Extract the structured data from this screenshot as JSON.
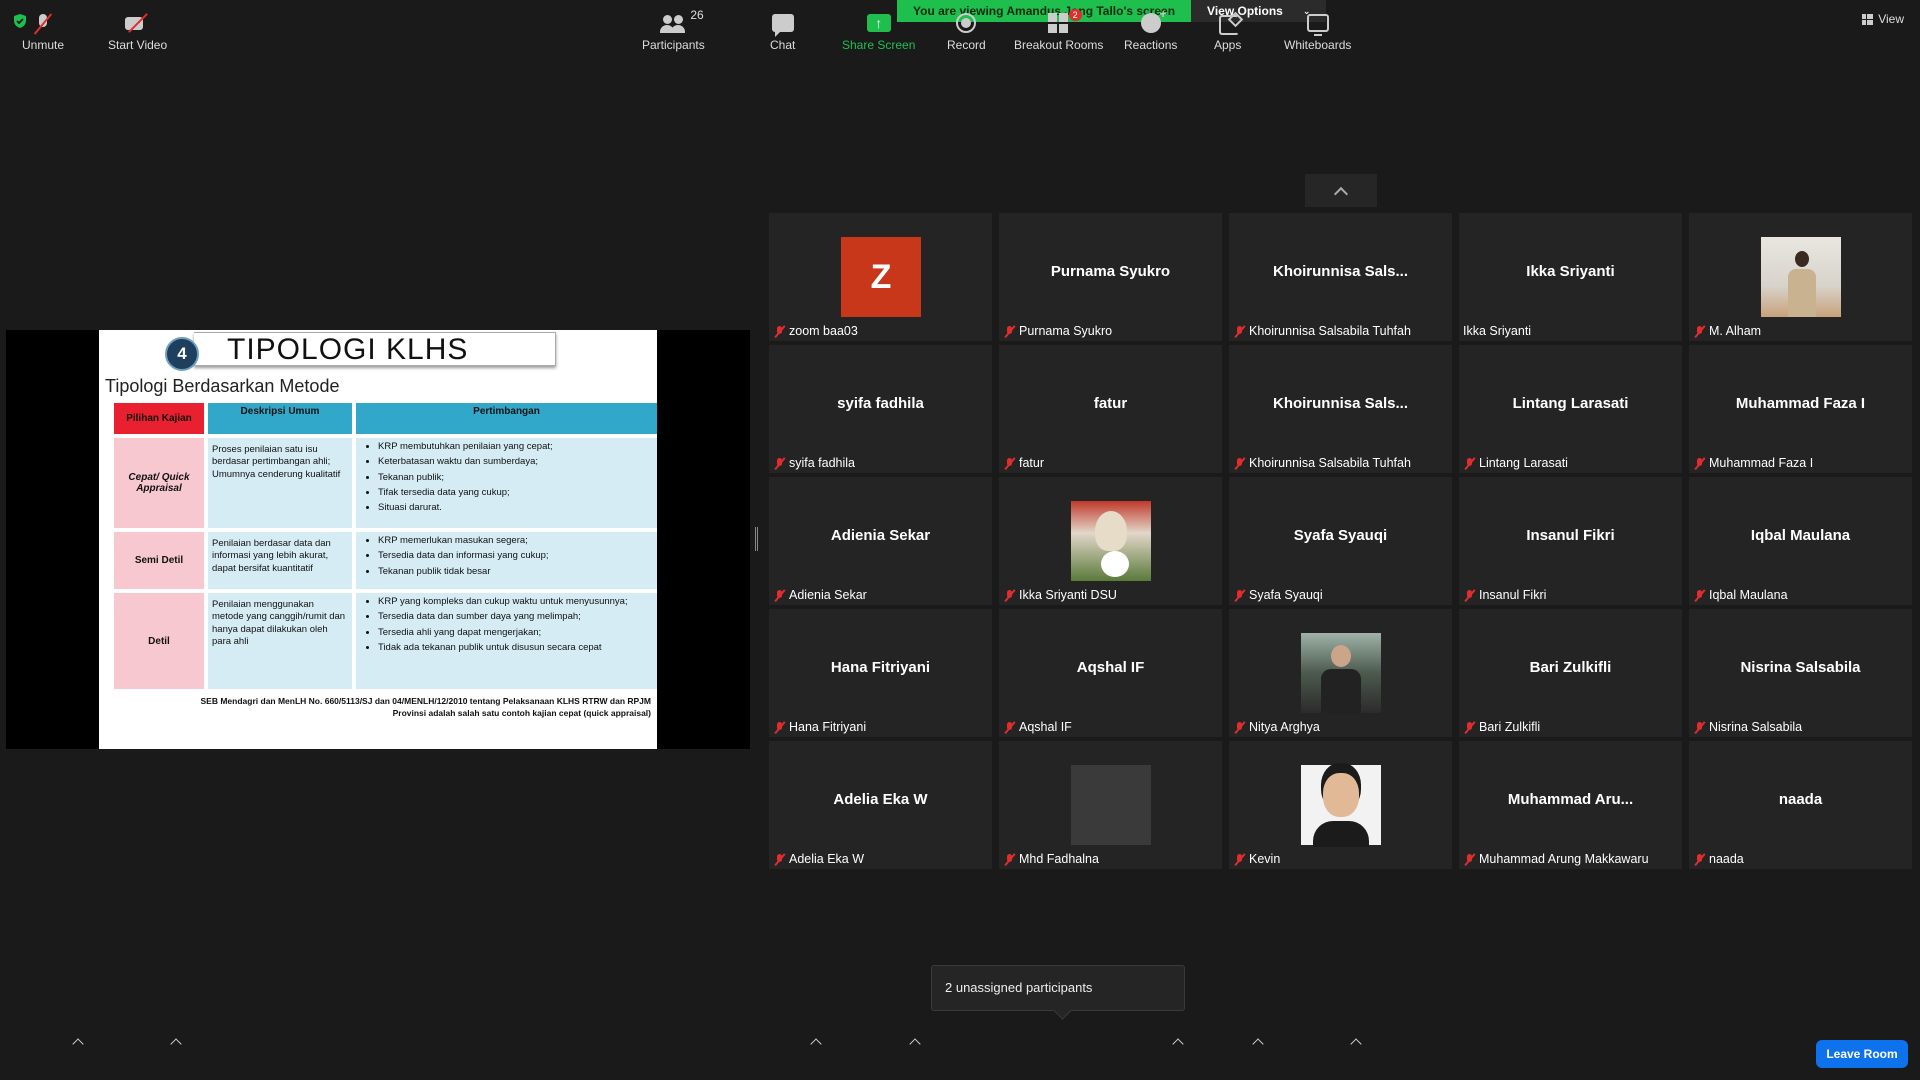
{
  "banner": {
    "viewing_text": "You are viewing Amandus Jong Tallo's screen",
    "view_options_label": "View Options"
  },
  "view_label": "View",
  "slide": {
    "number": "4",
    "title": "TIPOLOGI  KLHS",
    "subtitle": "Tipologi Berdasarkan Metode",
    "headers": [
      "Pilihan Kajian",
      "Deskripsi Umum",
      "Pertimbangan"
    ],
    "rows": [
      {
        "label": "Cepat/ Quick Appraisal",
        "desc": "Proses penilaian satu isu berdasar pertimbangan ahli; Umumnya cenderung kualitatif",
        "points": [
          "KRP membutuhkan penilaian yang cepat;",
          "Keterbatasan waktu dan sumberdaya;",
          "Tekanan publik;",
          "Tifak tersedia data yang cukup;",
          "Situasi darurat."
        ]
      },
      {
        "label": "Semi Detil",
        "desc": "Penilaian berdasar data dan informasi yang lebih akurat, dapat bersifat kuantitatif",
        "points": [
          "KRP memerlukan masukan segera;",
          "Tersedia data dan informasi yang cukup;",
          "Tekanan publik tidak besar"
        ]
      },
      {
        "label": "Detil",
        "desc": "Penilaian menggunakan metode yang canggih/rumit dan hanya dapat dilakukan oleh para ahli",
        "points": [
          "KRP yang kompleks dan cukup waktu untuk menyusunnya;",
          "Tersedia data dan sumber daya yang melimpah;",
          "Tersedia ahli yang dapat mengerjakan;",
          "Tidak ada tekanan publik untuk disusun secara cepat"
        ]
      }
    ],
    "footnote_line1": "SEB Mendagri dan MenLH No. 660/5113/SJ dan 04/MENLH/12/2010 tentang Pelaksanaan KLHS RTRW dan RPJM",
    "footnote_line2": "Provinsi adalah salah satu contoh kajian cepat (quick appraisal)"
  },
  "participants": [
    {
      "display": "",
      "name": "zoom baa03",
      "muted": true,
      "avatar": "Z"
    },
    {
      "display": "Purnama Syukro",
      "name": "Purnama Syukro",
      "muted": true
    },
    {
      "display": "Khoirunnisa  Sals...",
      "name": "Khoirunnisa Salsabila Tuhfah",
      "muted": true
    },
    {
      "display": "Ikka Sriyanti",
      "name": "Ikka Sriyanti",
      "muted": false
    },
    {
      "display": "",
      "name": "M. Alham",
      "muted": true,
      "photo": "alham"
    },
    {
      "display": "syifa fadhila",
      "name": "syifa fadhila",
      "muted": true
    },
    {
      "display": "fatur",
      "name": "fatur",
      "muted": true
    },
    {
      "display": "Khoirunnisa  Sals...",
      "name": "Khoirunnisa Salsabila Tuhfah",
      "muted": true
    },
    {
      "display": "Lintang Larasati",
      "name": "Lintang Larasati",
      "muted": true
    },
    {
      "display": "Muhammad Faza I",
      "name": "Muhammad Faza I",
      "muted": true
    },
    {
      "display": "Adienia Sekar",
      "name": "Adienia Sekar",
      "muted": true
    },
    {
      "display": "",
      "name": "Ikka Sriyanti DSU",
      "muted": true,
      "photo": "ikka"
    },
    {
      "display": "Syafa Syauqi",
      "name": "Syafa Syauqi",
      "muted": true
    },
    {
      "display": "Insanul Fikri",
      "name": "Insanul Fikri",
      "muted": true
    },
    {
      "display": "Iqbal Maulana",
      "name": "Iqbal Maulana",
      "muted": true
    },
    {
      "display": "Hana Fitriyani",
      "name": "Hana Fitriyani",
      "muted": true
    },
    {
      "display": "Aqshal IF",
      "name": "Aqshal IF",
      "muted": true
    },
    {
      "display": "",
      "name": "Nitya Arghya",
      "muted": true,
      "photo": "nitya"
    },
    {
      "display": "Bari Zulkifli",
      "name": "Bari Zulkifli",
      "muted": true
    },
    {
      "display": "Nisrina Salsabila",
      "name": "Nisrina Salsabila",
      "muted": true
    },
    {
      "display": "Adelia Eka W",
      "name": "Adelia Eka W",
      "muted": true
    },
    {
      "display": "",
      "name": "Mhd Fadhalna",
      "muted": true,
      "photo": "mhd"
    },
    {
      "display": "",
      "name": "Kevin",
      "muted": true,
      "photo": "kevin"
    },
    {
      "display": "Muhammad  Aru...",
      "name": "Muhammad Arung Makkawaru",
      "muted": true
    },
    {
      "display": "naada",
      "name": "naada",
      "muted": true
    }
  ],
  "tooltip": "2 unassigned participants",
  "toolbar": {
    "unmute": "Unmute",
    "start_video": "Start Video",
    "participants": "Participants",
    "participants_count": "26",
    "chat": "Chat",
    "share_screen": "Share Screen",
    "record": "Record",
    "breakout_rooms": "Breakout Rooms",
    "breakout_badge": "2",
    "reactions": "Reactions",
    "apps": "Apps",
    "whiteboards": "Whiteboards",
    "leave": "Leave Room"
  },
  "colors": {
    "banner_green": "#1fbf4d",
    "muted_red": "#e02d2d",
    "leave_blue": "#0e72ed",
    "avatar_orange": "#c8371a"
  }
}
